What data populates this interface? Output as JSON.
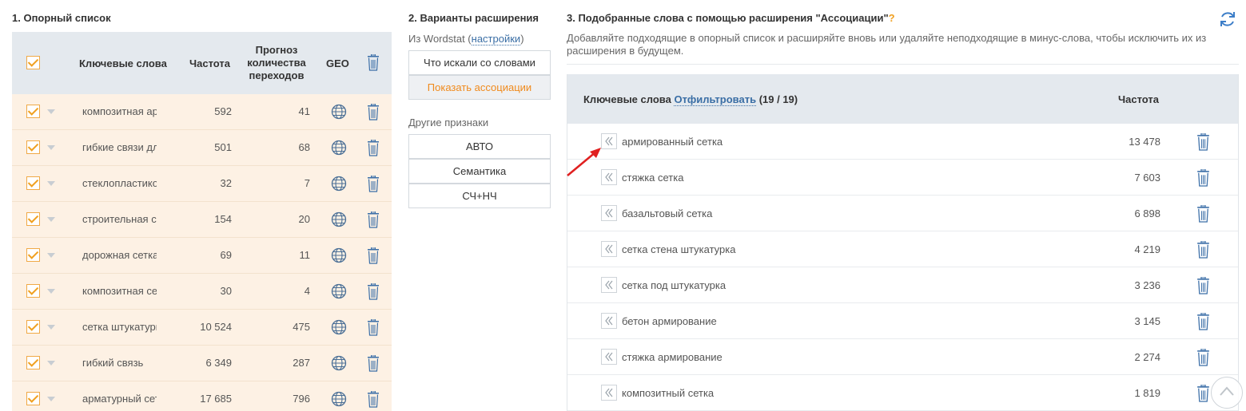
{
  "section1": {
    "title": "1. Опорный список",
    "headers": {
      "keywords": "Ключевые слова",
      "frequency": "Частота",
      "forecast": "Прогноз количества переходов",
      "geo": "GEO"
    },
    "rows": [
      {
        "keyword": "композитная арматура",
        "frequency": "592",
        "forecast": "41"
      },
      {
        "keyword": "гибкие связи для кладки",
        "frequency": "501",
        "forecast": "68"
      },
      {
        "keyword": "стеклопластиковая арматура",
        "frequency": "32",
        "forecast": "7"
      },
      {
        "keyword": "строительная сетка",
        "frequency": "154",
        "forecast": "20"
      },
      {
        "keyword": "дорожная сетка",
        "frequency": "69",
        "forecast": "11"
      },
      {
        "keyword": "композитная сетка",
        "frequency": "30",
        "forecast": "4"
      },
      {
        "keyword": "сетка штукатурная",
        "frequency": "10 524",
        "forecast": "475"
      },
      {
        "keyword": "гибкий связь",
        "frequency": "6 349",
        "forecast": "287"
      },
      {
        "keyword": "арматурный сетка",
        "frequency": "17 685",
        "forecast": "796"
      }
    ]
  },
  "section2": {
    "title": "2. Варианты расширения",
    "source_prefix": "Из Wordstat (",
    "source_link": "настройки",
    "source_suffix": ")",
    "buttons": [
      "Что искали со словами",
      "Показать ассоциации"
    ],
    "other_label": "Другие признаки",
    "other_buttons": [
      "АВТО",
      "Семантика",
      "СЧ+НЧ"
    ]
  },
  "section3": {
    "title": "3. Подобранные слова с помощью расширения \"Ассоциации\"",
    "help": "?",
    "description": "Добавляйте подходящие в опорный список и расширяйте вновь или удаляйте неподходящие в минус-слова, чтобы исключить их из расширения в будущем.",
    "header_keywords": "Ключевые слова",
    "filter_link": "Отфильтровать",
    "count": "(19 / 19)",
    "header_frequency": "Частота",
    "rows": [
      {
        "keyword": "армированный сетка",
        "frequency": "13 478"
      },
      {
        "keyword": "стяжка сетка",
        "frequency": "7 603"
      },
      {
        "keyword": "базальтовый сетка",
        "frequency": "6 898"
      },
      {
        "keyword": "сетка стена штукатурка",
        "frequency": "4 219"
      },
      {
        "keyword": "сетка под штукатурка",
        "frequency": "3 236"
      },
      {
        "keyword": "бетон армирование",
        "frequency": "3 145"
      },
      {
        "keyword": "стяжка армирование",
        "frequency": "2 274"
      },
      {
        "keyword": "композитный сетка",
        "frequency": "1 819"
      }
    ]
  },
  "colors": {
    "accent": "#f08a1c",
    "link": "#3a6ea5",
    "annotation_arrow": "#e02020"
  }
}
